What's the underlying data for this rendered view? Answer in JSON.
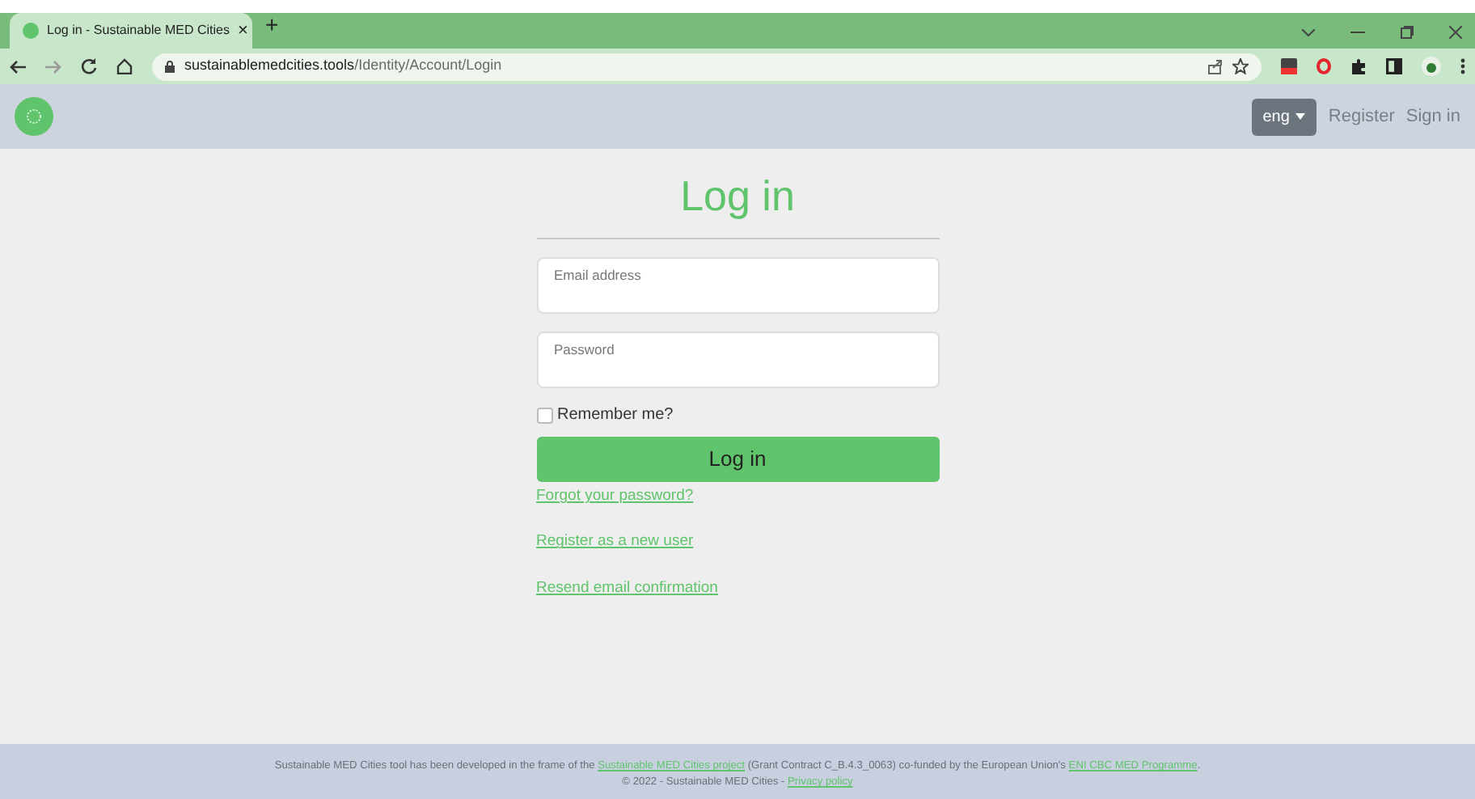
{
  "browser": {
    "tab_title": "Log in - Sustainable MED Cities",
    "tab_close": "×",
    "new_tab": "+",
    "url_host": "sustainablemedcities.tools",
    "url_path": "/Identity/Account/Login"
  },
  "navbar": {
    "language": "eng",
    "links": [
      {
        "label": "Register"
      },
      {
        "label": "Sign in"
      }
    ]
  },
  "form": {
    "title": "Log in",
    "fields": [
      {
        "placeholder": "Email address"
      },
      {
        "placeholder": "Password"
      }
    ],
    "remember": {
      "label": "Remember me?",
      "checked": false
    },
    "submit": "Log in",
    "links": [
      {
        "label": "Forgot your password?"
      },
      {
        "label": "Register as a new user"
      },
      {
        "label": "Resend email confirmation"
      }
    ]
  },
  "footer": {
    "parts": [
      {
        "kind": "text",
        "text": "Sustainable MED Cities tool has been developed in the frame of the "
      },
      {
        "kind": "link",
        "text": "Sustainable MED Cities project"
      },
      {
        "kind": "text",
        "text": " (Grant Contract C_B.4.3_0063) co-funded by the European Union's "
      },
      {
        "kind": "link",
        "text": "ENI CBC MED Programme"
      },
      {
        "kind": "text",
        "text": "."
      }
    ],
    "copyright": "© 2022 - Sustainable MED Cities - ",
    "privacy": "Privacy policy"
  }
}
